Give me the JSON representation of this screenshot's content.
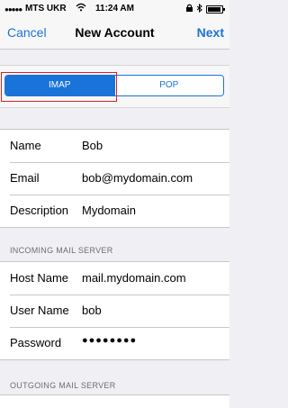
{
  "status_bar": {
    "signal": "●●●●●",
    "carrier": "MTS UKR",
    "wifi_icon": "wifi-icon",
    "time": "11:24 AM",
    "lock_icon": "lock-rotation-icon",
    "bluetooth_icon": "bluetooth-icon",
    "battery_level": 0.9
  },
  "navbar": {
    "cancel_label": "Cancel",
    "title": "New Account",
    "next_label": "Next"
  },
  "account_type": {
    "options": [
      "IMAP",
      "POP"
    ],
    "selected": "IMAP"
  },
  "account_info": {
    "name_label": "Name",
    "name_value": "Bob",
    "email_label": "Email",
    "email_value": "bob@mydomain.com",
    "description_label": "Description",
    "description_value": "Mydomain"
  },
  "incoming": {
    "header": "INCOMING MAIL SERVER",
    "host_label": "Host Name",
    "host_value": "mail.mydomain.com",
    "user_label": "User Name",
    "user_value": "bob",
    "password_label": "Password",
    "password_value": "●●●●●●●●"
  },
  "outgoing": {
    "header": "OUTGOING MAIL SERVER"
  },
  "colors": {
    "accent": "#1a73d9",
    "highlight": "#e02020"
  }
}
